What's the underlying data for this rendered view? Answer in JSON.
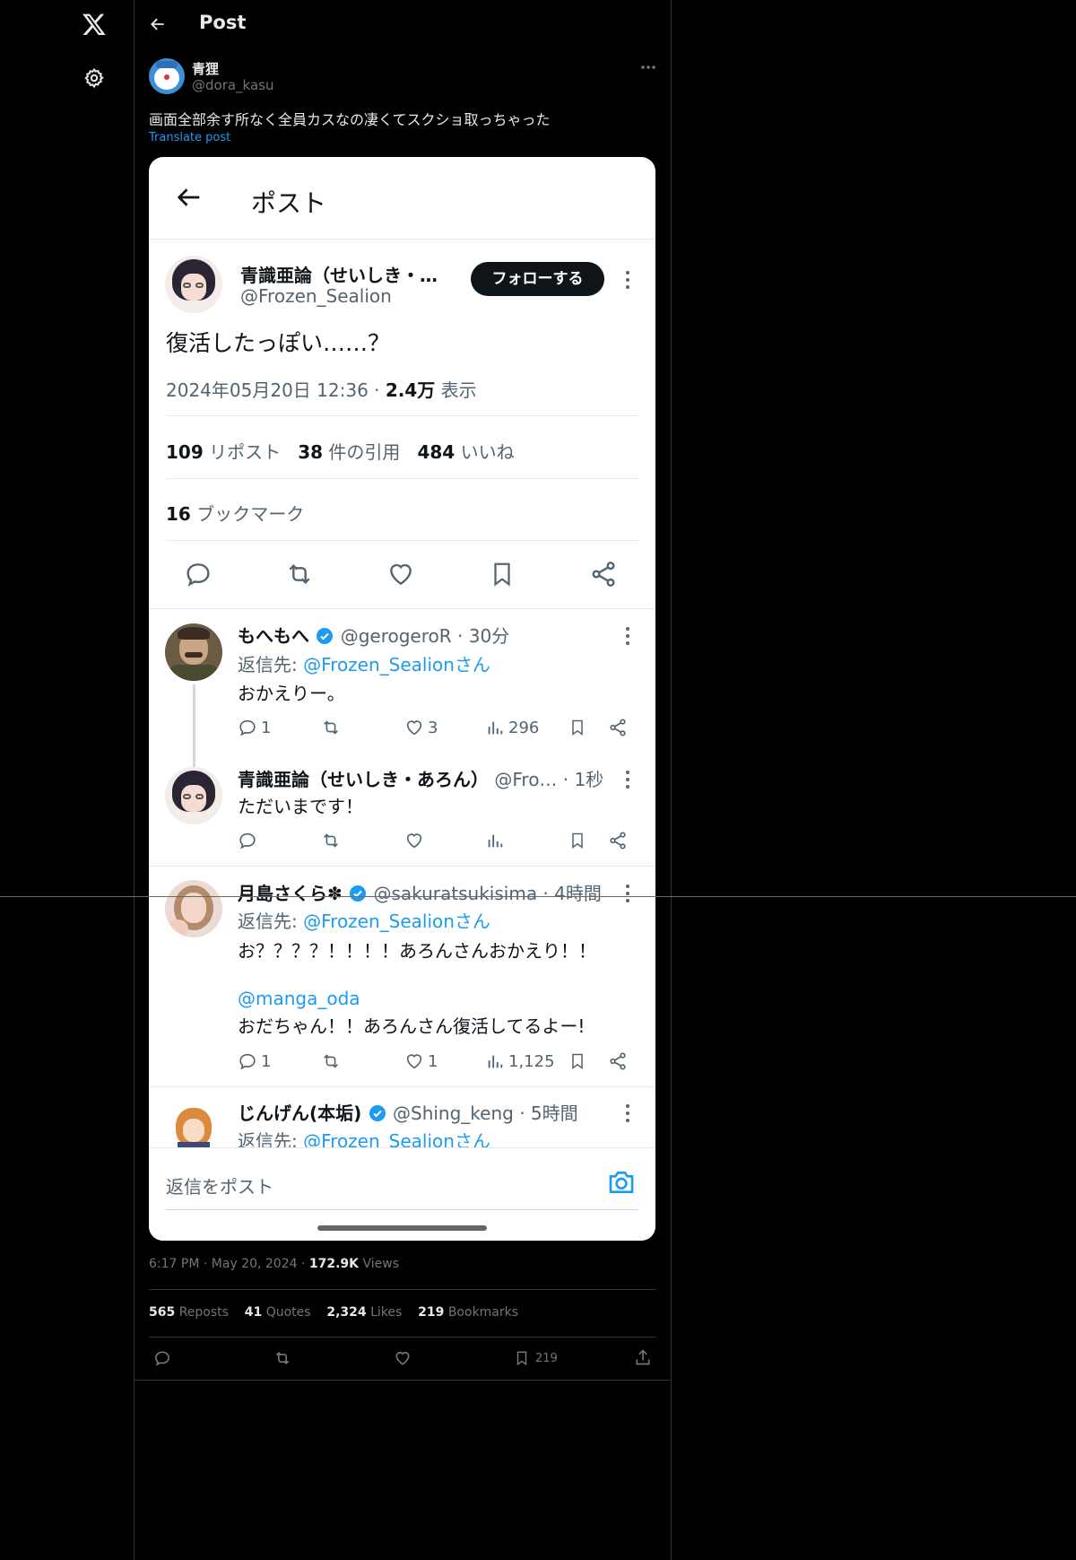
{
  "header": {
    "title": "Post"
  },
  "post": {
    "author_name": "青狸",
    "author_handle": "@dora_kasu",
    "text": "画面全部余す所なく全員カスなの凄くてスクショ取っちゃった",
    "translate_label": "Translate post",
    "time": "6:17 PM",
    "date": "May 20, 2024",
    "views_count": "172.9K",
    "views_label": "Views",
    "stats": {
      "reposts_count": "565",
      "reposts_label": "Reposts",
      "quotes_count": "41",
      "quotes_label": "Quotes",
      "likes_count": "2,324",
      "likes_label": "Likes",
      "bookmarks_count": "219",
      "bookmarks_label": "Bookmarks"
    },
    "bookmark_action_count": "219"
  },
  "shot": {
    "header_title": "ポスト",
    "main": {
      "name": "青識亜論（せいしき・…",
      "handle": "@Frozen_Sealion",
      "follow_label": "フォローする",
      "text": "復活したっぽい……？",
      "meta_date": "2024年05月20日 12:36 · ",
      "meta_views_num": "2.4万",
      "meta_views_label": " 表示",
      "reposts_num": "109",
      "reposts_label": " リポスト",
      "quotes_num": "38",
      "quotes_label": " 件の引用",
      "likes_num": "484",
      "likes_label": " いいね",
      "bookmarks_num": "16",
      "bookmarks_label": " ブックマーク"
    },
    "replies": [
      {
        "name": "もへもへ",
        "handle_time": "@gerogeroR · 30分",
        "reply_prefix": "返信先: ",
        "reply_to": "@Frozen_Sealionさん",
        "text": "おかえりー。",
        "replies": "1",
        "likes": "3",
        "views": "296"
      },
      {
        "name": "青識亜論（せいしき・あろん）",
        "handle_time": "@Fro… · 1秒",
        "text": "ただいまです！"
      },
      {
        "name": "月島さくら✽",
        "handle_time": "@sakuratsukisima · 4時間",
        "reply_prefix": "返信先: ",
        "reply_to": "@Frozen_Sealionさん",
        "text1": "お？？？？！！！！あろんさんおかえり！！",
        "mention": "@manga_oda",
        "text2": "おだちゃん！！あろんさん復活してるよー!",
        "replies": "1",
        "likes": "1",
        "views": "1,125"
      },
      {
        "name": "じんげん(本垢)",
        "handle_time": "@Shing_keng · 5時間",
        "reply_prefix": "返信先: ",
        "reply_to": "@Frozen_Sealionさん"
      }
    ],
    "compose_placeholder": "返信をポスト"
  },
  "colors": {
    "accent": "#1d9bf0",
    "bg": "#000000",
    "card_bg": "#ffffff"
  }
}
